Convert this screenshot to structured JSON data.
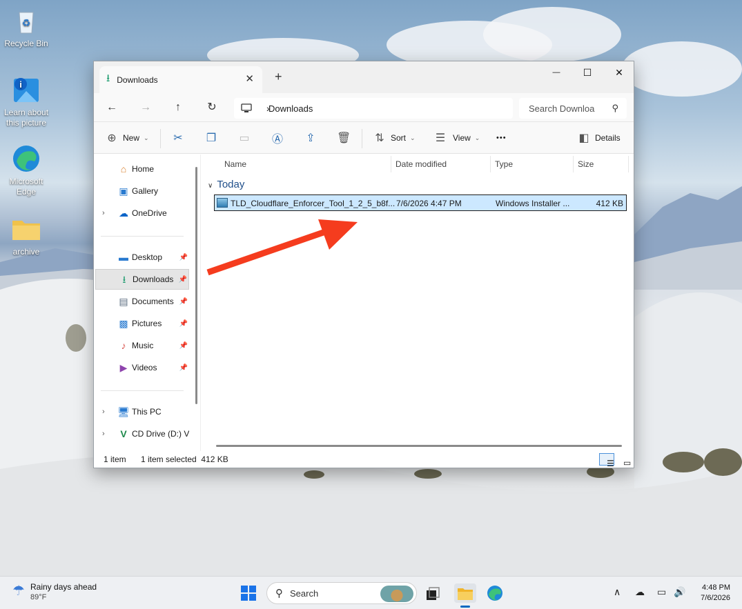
{
  "desktop": {
    "icons": [
      {
        "label": "Recycle Bin"
      },
      {
        "label": "Learn about this picture"
      },
      {
        "label": "Microsoft Edge"
      },
      {
        "label": "archive"
      }
    ]
  },
  "window": {
    "tab_title": "Downloads",
    "tab_close": "✕",
    "new_tab": "+",
    "controls": {
      "minimize": "—",
      "maximize": "☐",
      "close": "✕"
    },
    "nav": {
      "back": "←",
      "forward": "→",
      "up": "↑",
      "refresh": "↻"
    },
    "address": {
      "separator": "›",
      "location": "Downloads"
    },
    "search": {
      "placeholder": "Search Downloa",
      "icon": "search-icon"
    },
    "toolbar": {
      "new_label": "New",
      "sort_label": "Sort",
      "view_label": "View",
      "more_label": "•••",
      "details_label": "Details"
    },
    "sidebar": {
      "items": [
        {
          "label": "Home",
          "icon": "home-icon"
        },
        {
          "label": "Gallery",
          "icon": "gallery-icon"
        },
        {
          "label": "OneDrive",
          "icon": "cloud-icon"
        },
        {
          "label": "Desktop",
          "icon": "desktop-icon"
        },
        {
          "label": "Downloads",
          "icon": "download-icon"
        },
        {
          "label": "Documents",
          "icon": "document-icon"
        },
        {
          "label": "Pictures",
          "icon": "pictures-icon"
        },
        {
          "label": "Music",
          "icon": "music-icon"
        },
        {
          "label": "Videos",
          "icon": "videos-icon"
        },
        {
          "label": "This PC",
          "icon": "computer-icon"
        },
        {
          "label": "CD Drive (D:) Vir",
          "icon": "cd-drive-icon"
        }
      ]
    },
    "columns": {
      "name": "Name",
      "date": "Date modified",
      "type": "Type",
      "size": "Size"
    },
    "group_label": "Today",
    "file": {
      "name": "TLD_Cloudflare_Enforcer_Tool_1_2_5_b8f...",
      "date": "7/6/2026 4:47 PM",
      "type": "Windows Installer ...",
      "size": "412 KB"
    },
    "status": {
      "count": "1 item",
      "selection": "1 item selected  412 KB"
    }
  },
  "taskbar": {
    "weather": {
      "line1": "Rainy days ahead",
      "line2": "89°F"
    },
    "search_label": "Search",
    "clock": {
      "time": "4:48 PM",
      "date": "7/6/2026"
    }
  },
  "colors": {
    "accent": "#0067c0",
    "arrow": "#f53c1e",
    "selection": "#cce8ff"
  }
}
